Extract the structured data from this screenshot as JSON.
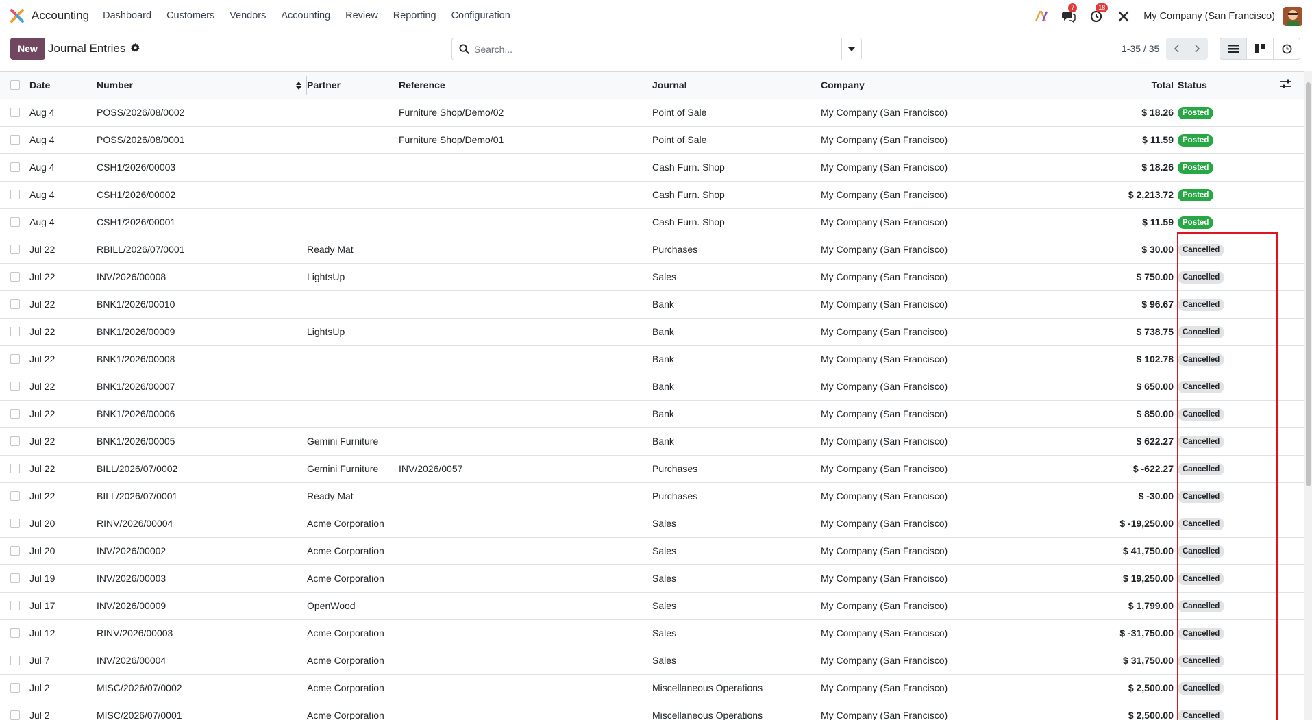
{
  "navbar": {
    "app_name": "Accounting",
    "menu": [
      "Dashboard",
      "Customers",
      "Vendors",
      "Accounting",
      "Review",
      "Reporting",
      "Configuration"
    ],
    "messages_count": "7",
    "activities_count": "18",
    "company": "My Company (San Francisco)"
  },
  "control": {
    "new_label": "New",
    "title": "Journal Entries",
    "search_placeholder": "Search...",
    "pager": "1-35 / 35"
  },
  "table": {
    "headers": {
      "date": "Date",
      "number": "Number",
      "partner": "Partner",
      "reference": "Reference",
      "journal": "Journal",
      "company": "Company",
      "total": "Total",
      "status": "Status"
    },
    "rows": [
      {
        "date": "Aug 4",
        "number": "POSS/2026/08/0002",
        "partner": "",
        "reference": "Furniture Shop/Demo/02",
        "journal": "Point of Sale",
        "company": "My Company (San Francisco)",
        "total": "$ 18.26",
        "status": "Posted"
      },
      {
        "date": "Aug 4",
        "number": "POSS/2026/08/0001",
        "partner": "",
        "reference": "Furniture Shop/Demo/01",
        "journal": "Point of Sale",
        "company": "My Company (San Francisco)",
        "total": "$ 11.59",
        "status": "Posted"
      },
      {
        "date": "Aug 4",
        "number": "CSH1/2026/00003",
        "partner": "",
        "reference": "",
        "journal": "Cash Furn. Shop",
        "company": "My Company (San Francisco)",
        "total": "$ 18.26",
        "status": "Posted"
      },
      {
        "date": "Aug 4",
        "number": "CSH1/2026/00002",
        "partner": "",
        "reference": "",
        "journal": "Cash Furn. Shop",
        "company": "My Company (San Francisco)",
        "total": "$ 2,213.72",
        "status": "Posted"
      },
      {
        "date": "Aug 4",
        "number": "CSH1/2026/00001",
        "partner": "",
        "reference": "",
        "journal": "Cash Furn. Shop",
        "company": "My Company (San Francisco)",
        "total": "$ 11.59",
        "status": "Posted"
      },
      {
        "date": "Jul 22",
        "number": "RBILL/2026/07/0001",
        "partner": "Ready Mat",
        "reference": "",
        "journal": "Purchases",
        "company": "My Company (San Francisco)",
        "total": "$ 30.00",
        "status": "Cancelled"
      },
      {
        "date": "Jul 22",
        "number": "INV/2026/00008",
        "partner": "LightsUp",
        "reference": "",
        "journal": "Sales",
        "company": "My Company (San Francisco)",
        "total": "$ 750.00",
        "status": "Cancelled"
      },
      {
        "date": "Jul 22",
        "number": "BNK1/2026/00010",
        "partner": "",
        "reference": "",
        "journal": "Bank",
        "company": "My Company (San Francisco)",
        "total": "$ 96.67",
        "status": "Cancelled"
      },
      {
        "date": "Jul 22",
        "number": "BNK1/2026/00009",
        "partner": "LightsUp",
        "reference": "",
        "journal": "Bank",
        "company": "My Company (San Francisco)",
        "total": "$ 738.75",
        "status": "Cancelled"
      },
      {
        "date": "Jul 22",
        "number": "BNK1/2026/00008",
        "partner": "",
        "reference": "",
        "journal": "Bank",
        "company": "My Company (San Francisco)",
        "total": "$ 102.78",
        "status": "Cancelled"
      },
      {
        "date": "Jul 22",
        "number": "BNK1/2026/00007",
        "partner": "",
        "reference": "",
        "journal": "Bank",
        "company": "My Company (San Francisco)",
        "total": "$ 650.00",
        "status": "Cancelled"
      },
      {
        "date": "Jul 22",
        "number": "BNK1/2026/00006",
        "partner": "",
        "reference": "",
        "journal": "Bank",
        "company": "My Company (San Francisco)",
        "total": "$ 850.00",
        "status": "Cancelled"
      },
      {
        "date": "Jul 22",
        "number": "BNK1/2026/00005",
        "partner": "Gemini Furniture",
        "reference": "",
        "journal": "Bank",
        "company": "My Company (San Francisco)",
        "total": "$ 622.27",
        "status": "Cancelled"
      },
      {
        "date": "Jul 22",
        "number": "BILL/2026/07/0002",
        "partner": "Gemini Furniture",
        "reference": "INV/2026/0057",
        "journal": "Purchases",
        "company": "My Company (San Francisco)",
        "total": "$ -622.27",
        "status": "Cancelled"
      },
      {
        "date": "Jul 22",
        "number": "BILL/2026/07/0001",
        "partner": "Ready Mat",
        "reference": "",
        "journal": "Purchases",
        "company": "My Company (San Francisco)",
        "total": "$ -30.00",
        "status": "Cancelled"
      },
      {
        "date": "Jul 20",
        "number": "RINV/2026/00004",
        "partner": "Acme Corporation",
        "reference": "",
        "journal": "Sales",
        "company": "My Company (San Francisco)",
        "total": "$ -19,250.00",
        "status": "Cancelled"
      },
      {
        "date": "Jul 20",
        "number": "INV/2026/00002",
        "partner": "Acme Corporation",
        "reference": "",
        "journal": "Sales",
        "company": "My Company (San Francisco)",
        "total": "$ 41,750.00",
        "status": "Cancelled"
      },
      {
        "date": "Jul 19",
        "number": "INV/2026/00003",
        "partner": "Acme Corporation",
        "reference": "",
        "journal": "Sales",
        "company": "My Company (San Francisco)",
        "total": "$ 19,250.00",
        "status": "Cancelled"
      },
      {
        "date": "Jul 17",
        "number": "INV/2026/00009",
        "partner": "OpenWood",
        "reference": "",
        "journal": "Sales",
        "company": "My Company (San Francisco)",
        "total": "$ 1,799.00",
        "status": "Cancelled"
      },
      {
        "date": "Jul 12",
        "number": "RINV/2026/00003",
        "partner": "Acme Corporation",
        "reference": "",
        "journal": "Sales",
        "company": "My Company (San Francisco)",
        "total": "$ -31,750.00",
        "status": "Cancelled"
      },
      {
        "date": "Jul 7",
        "number": "INV/2026/00004",
        "partner": "Acme Corporation",
        "reference": "",
        "journal": "Sales",
        "company": "My Company (San Francisco)",
        "total": "$ 31,750.00",
        "status": "Cancelled"
      },
      {
        "date": "Jul 2",
        "number": "MISC/2026/07/0002",
        "partner": "Acme Corporation",
        "reference": "",
        "journal": "Miscellaneous Operations",
        "company": "My Company (San Francisco)",
        "total": "$ 2,500.00",
        "status": "Cancelled"
      },
      {
        "date": "Jul 2",
        "number": "MISC/2026/07/0001",
        "partner": "Acme Corporation",
        "reference": "",
        "journal": "Miscellaneous Operations",
        "company": "My Company (San Francisco)",
        "total": "$ 2,500.00",
        "status": "Cancelled"
      }
    ]
  },
  "colors": {
    "brand": "#71475f",
    "posted": "#28a745",
    "cancelled_bg": "#e2e3e5",
    "highlight": "#e0141e",
    "badge_red": "#e23b3b"
  },
  "icons": [
    "accounting-logo",
    "ai-icon",
    "chat-icon",
    "clock-icon",
    "tools-icon",
    "gear-icon",
    "search-icon",
    "caret-down-icon",
    "chevron-left-icon",
    "chevron-right-icon",
    "list-view-icon",
    "kanban-view-icon",
    "activity-view-icon",
    "sort-icon",
    "optional-columns-icon"
  ]
}
